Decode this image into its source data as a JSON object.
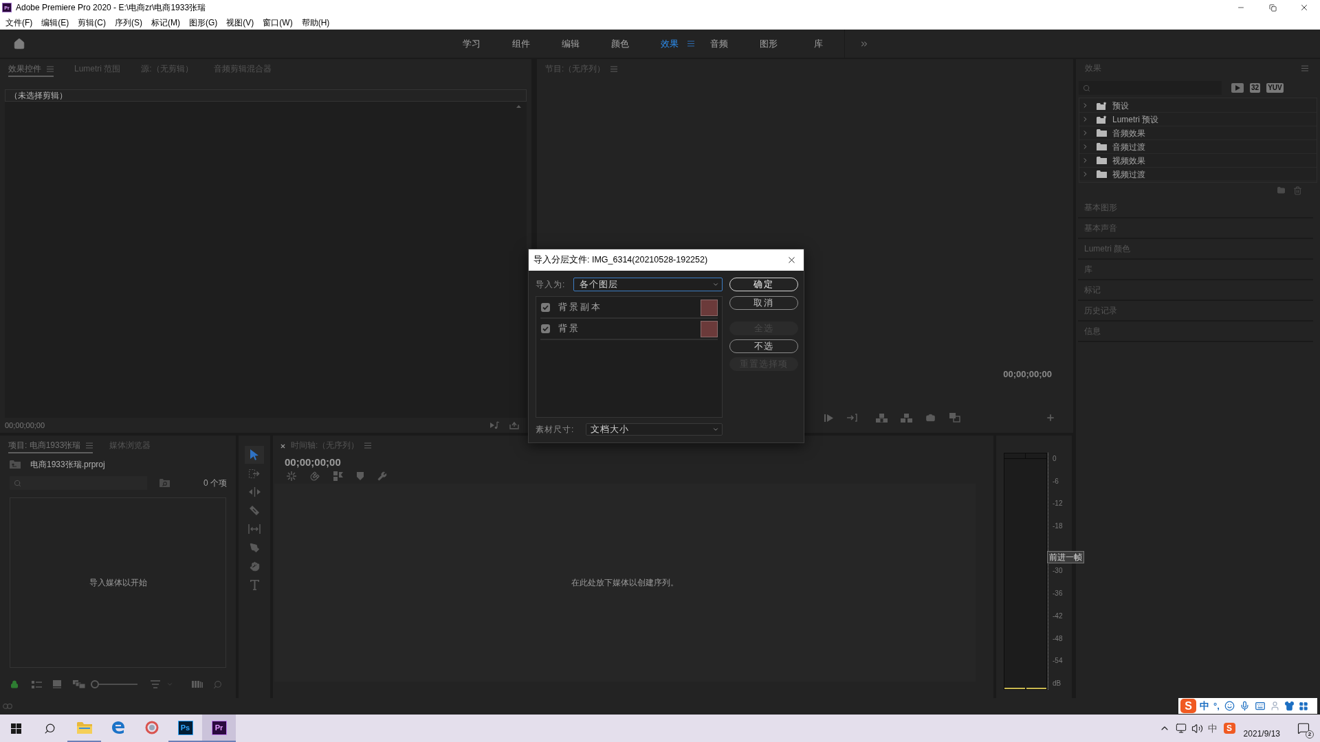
{
  "window": {
    "app_icon": "Pr",
    "title": "Adobe Premiere Pro 2020 - E:\\电商zr\\电商1933张瑞"
  },
  "menu": [
    "文件(F)",
    "编辑(E)",
    "剪辑(C)",
    "序列(S)",
    "标记(M)",
    "图形(G)",
    "视图(V)",
    "窗口(W)",
    "帮助(H)"
  ],
  "workspaces": [
    {
      "label": "学习",
      "selected": false
    },
    {
      "label": "组件",
      "selected": false
    },
    {
      "label": "编辑",
      "selected": false
    },
    {
      "label": "颜色",
      "selected": false
    },
    {
      "label": "效果",
      "selected": true
    },
    {
      "label": "音频",
      "selected": false
    },
    {
      "label": "图形",
      "selected": false
    },
    {
      "label": "库",
      "selected": false
    }
  ],
  "effect_controls_panel": {
    "tabs": [
      {
        "label": "效果控件",
        "selected": true
      },
      {
        "label": "Lumetri 范围",
        "selected": false
      },
      {
        "label": "源:（无剪辑）",
        "selected": false
      },
      {
        "label": "音频剪辑混合器",
        "selected": false
      }
    ],
    "clip_header": "（未选择剪辑）",
    "timecode": "00;00;00;00"
  },
  "program_monitor": {
    "tab": "节目:（无序列）",
    "timecode": "00;00;00;00"
  },
  "effects_panel": {
    "title": "效果",
    "filter_badges": [
      {
        "kind": "icon"
      },
      {
        "kind": "label",
        "label": "32"
      },
      {
        "kind": "label",
        "label": "YUV"
      }
    ],
    "tree": [
      {
        "label": "预设",
        "kind": "preset",
        "expanded": false
      },
      {
        "label": "Lumetri 预设",
        "kind": "preset",
        "expanded": false
      },
      {
        "label": "音频效果",
        "kind": "folder",
        "expanded": false
      },
      {
        "label": "音频过渡",
        "kind": "folder",
        "expanded": false
      },
      {
        "label": "视频效果",
        "kind": "folder",
        "expanded": false
      },
      {
        "label": "视频过渡",
        "kind": "folder",
        "expanded": false
      }
    ],
    "sections": [
      "基本图形",
      "基本声音",
      "Lumetri 颜色",
      "库",
      "标记",
      "历史记录",
      "信息"
    ]
  },
  "project_panel": {
    "tabs": [
      {
        "label": "项目: 电商1933张瑞",
        "selected": true
      },
      {
        "label": "媒体浏览器",
        "selected": false
      }
    ],
    "file": "电商1933张瑞.prproj",
    "item_count": "0 个项",
    "empty_message": "导入媒体以开始",
    "zoom_slider": {
      "level": 0
    }
  },
  "tools": [
    {
      "kind": "selection",
      "selected": true
    },
    {
      "kind": "track-select",
      "selected": false
    },
    {
      "kind": "ripple",
      "selected": false
    },
    {
      "kind": "razor",
      "selected": false
    },
    {
      "kind": "slip",
      "selected": false
    },
    {
      "kind": "pen",
      "selected": false
    },
    {
      "kind": "hand",
      "selected": false
    },
    {
      "kind": "type",
      "selected": false
    }
  ],
  "timeline": {
    "tab": "时间轴:（无序列）",
    "timecode": "00;00;00;00",
    "empty_message": "在此处放下媒体以创建序列。"
  },
  "audio_meter": {
    "scale_upper": [
      "0",
      "-6",
      "-12",
      "-18"
    ],
    "scale_lower": [
      "-30",
      "-36",
      "-42",
      "-48",
      "-54",
      "dB"
    ]
  },
  "tooltip": "前进一帧",
  "dialog": {
    "title": "导入分层文件: IMG_6314(20210528-192252)",
    "import_as_label": "导入为:",
    "import_as": "各个图层",
    "layers": [
      {
        "name": "背景副本",
        "checked": true
      },
      {
        "name": "背景",
        "checked": true
      }
    ],
    "buttons": [
      {
        "label": "确定",
        "default": true,
        "disabled": false
      },
      {
        "label": "取消",
        "default": false,
        "disabled": false
      }
    ],
    "selection_buttons": [
      {
        "label": "全选",
        "disabled": true
      },
      {
        "label": "不选",
        "disabled": false
      },
      {
        "label": "重置选择项",
        "disabled": true
      }
    ],
    "footage_size_label": "素材尺寸:",
    "footage_size": "文档大小"
  },
  "ime_bar": {
    "logo": "S",
    "mode": "中",
    "punctuation": "°,"
  },
  "taskbar": {
    "apps": [
      {
        "kind": "explorer",
        "running": true,
        "selected": false
      },
      {
        "kind": "edge",
        "running": false,
        "selected": false
      },
      {
        "kind": "app",
        "running": false,
        "selected": false
      },
      {
        "kind": "photoshop",
        "label": "Ps",
        "running": true,
        "selected": false
      },
      {
        "kind": "premiere",
        "label": "Pr",
        "running": true,
        "selected": true
      }
    ],
    "tray_language": "中",
    "tray_logo": "S",
    "date": "2021/9/13",
    "notifications": "2"
  }
}
